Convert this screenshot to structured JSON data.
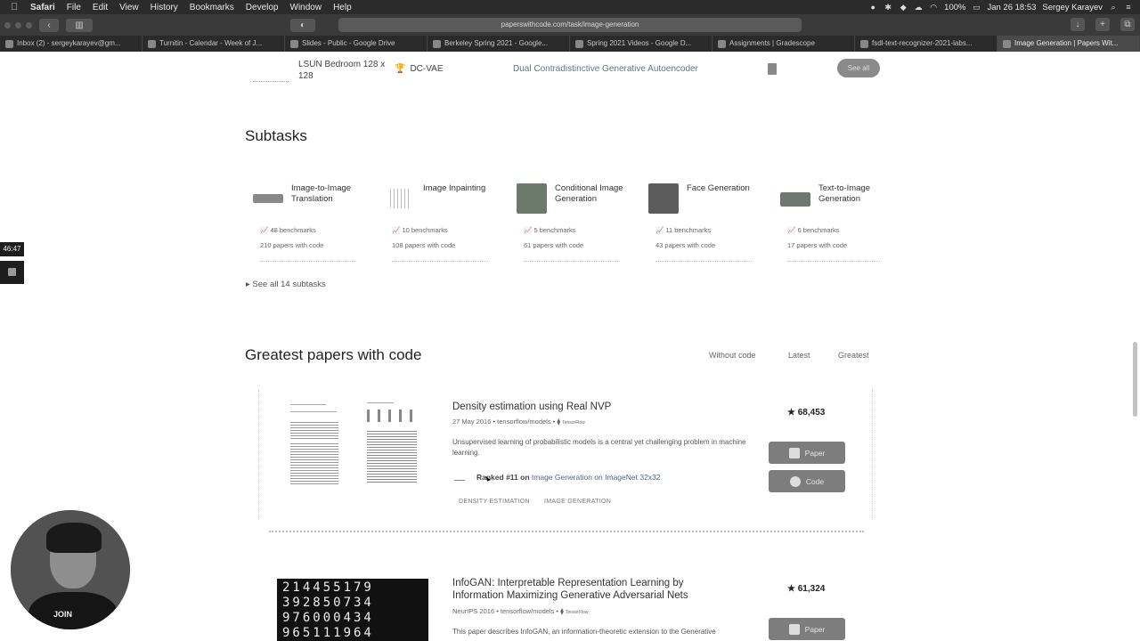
{
  "menubar": {
    "items": [
      "Safari",
      "File",
      "Edit",
      "View",
      "History",
      "Bookmarks",
      "Develop",
      "Window",
      "Help"
    ],
    "battery": "100%",
    "datetime": "Jan 26  18:53",
    "user": "Sergey Karayev"
  },
  "toolbar": {
    "url": "paperswithcode.com/task/image-generation"
  },
  "tabs": [
    {
      "label": "Inbox (2) - sergeykarayev@gm..."
    },
    {
      "label": "Turnitin - Calendar - Week of J..."
    },
    {
      "label": "Slides - Public - Google Drive"
    },
    {
      "label": "Berkeley Spring 2021 - Google..."
    },
    {
      "label": "Spring 2021 Videos - Google D..."
    },
    {
      "label": "Assignments | Gradescope"
    },
    {
      "label": "fsdl-text-recognizer-2021-labs..."
    },
    {
      "label": "Image Generation | Papers Wit..."
    }
  ],
  "top_row": {
    "dataset": "LSUN Bedroom 128 x 128",
    "model": "DC-VAE",
    "paper": "Dual Contradistinctive Generative Autoencoder",
    "see_all": "See all"
  },
  "subtasks": {
    "heading": "Subtasks",
    "items": [
      {
        "name": "Image-to-Image Translation",
        "benchmarks": "48 benchmarks",
        "papers": "210 papers with code"
      },
      {
        "name": "Image Inpainting",
        "benchmarks": "10 benchmarks",
        "papers": "108 papers with code"
      },
      {
        "name": "Conditional Image Generation",
        "benchmarks": "5 benchmarks",
        "papers": "61 papers with code"
      },
      {
        "name": "Face Generation",
        "benchmarks": "11 benchmarks",
        "papers": "43 papers with code"
      },
      {
        "name": "Text-to-Image Generation",
        "benchmarks": "6 benchmarks",
        "papers": "17 papers with code"
      }
    ],
    "see_all": "See all 14 subtasks"
  },
  "greatest": {
    "heading": "Greatest papers with code",
    "filters": [
      "Without code",
      "Latest",
      "Greatest"
    ],
    "papers": [
      {
        "title": "Density estimation using Real NVP",
        "meta": "27 May 2016 • tensorflow/models •",
        "framework": "TensorFlow",
        "abstract": "Unsupervised learning of probabilistic models is a central yet challenging problem in machine learning.",
        "rank_prefix": "Ranked #11 on",
        "rank_task": "Image Generation on ImageNet 32x32",
        "tags": [
          "DENSITY ESTIMATION",
          "IMAGE GENERATION"
        ],
        "stars": "68,453",
        "paper_btn": "Paper",
        "code_btn": "Code"
      },
      {
        "title": "InfoGAN: Interpretable Representation Learning by Information Maximizing Generative Adversarial Nets",
        "meta": "NeurIPS 2016 • tensorflow/models •",
        "framework": "TensorFlow",
        "abstract": "This paper describes InfoGAN, an information-theoretic extension to the Generative",
        "stars": "61,324",
        "paper_btn": "Paper"
      }
    ]
  },
  "recording": {
    "timer": "46:47"
  },
  "webcam": {
    "shirt_text": "JOIN"
  },
  "mnist_rows": [
    "214455179",
    "392850734",
    "976000434",
    "965111964"
  ]
}
